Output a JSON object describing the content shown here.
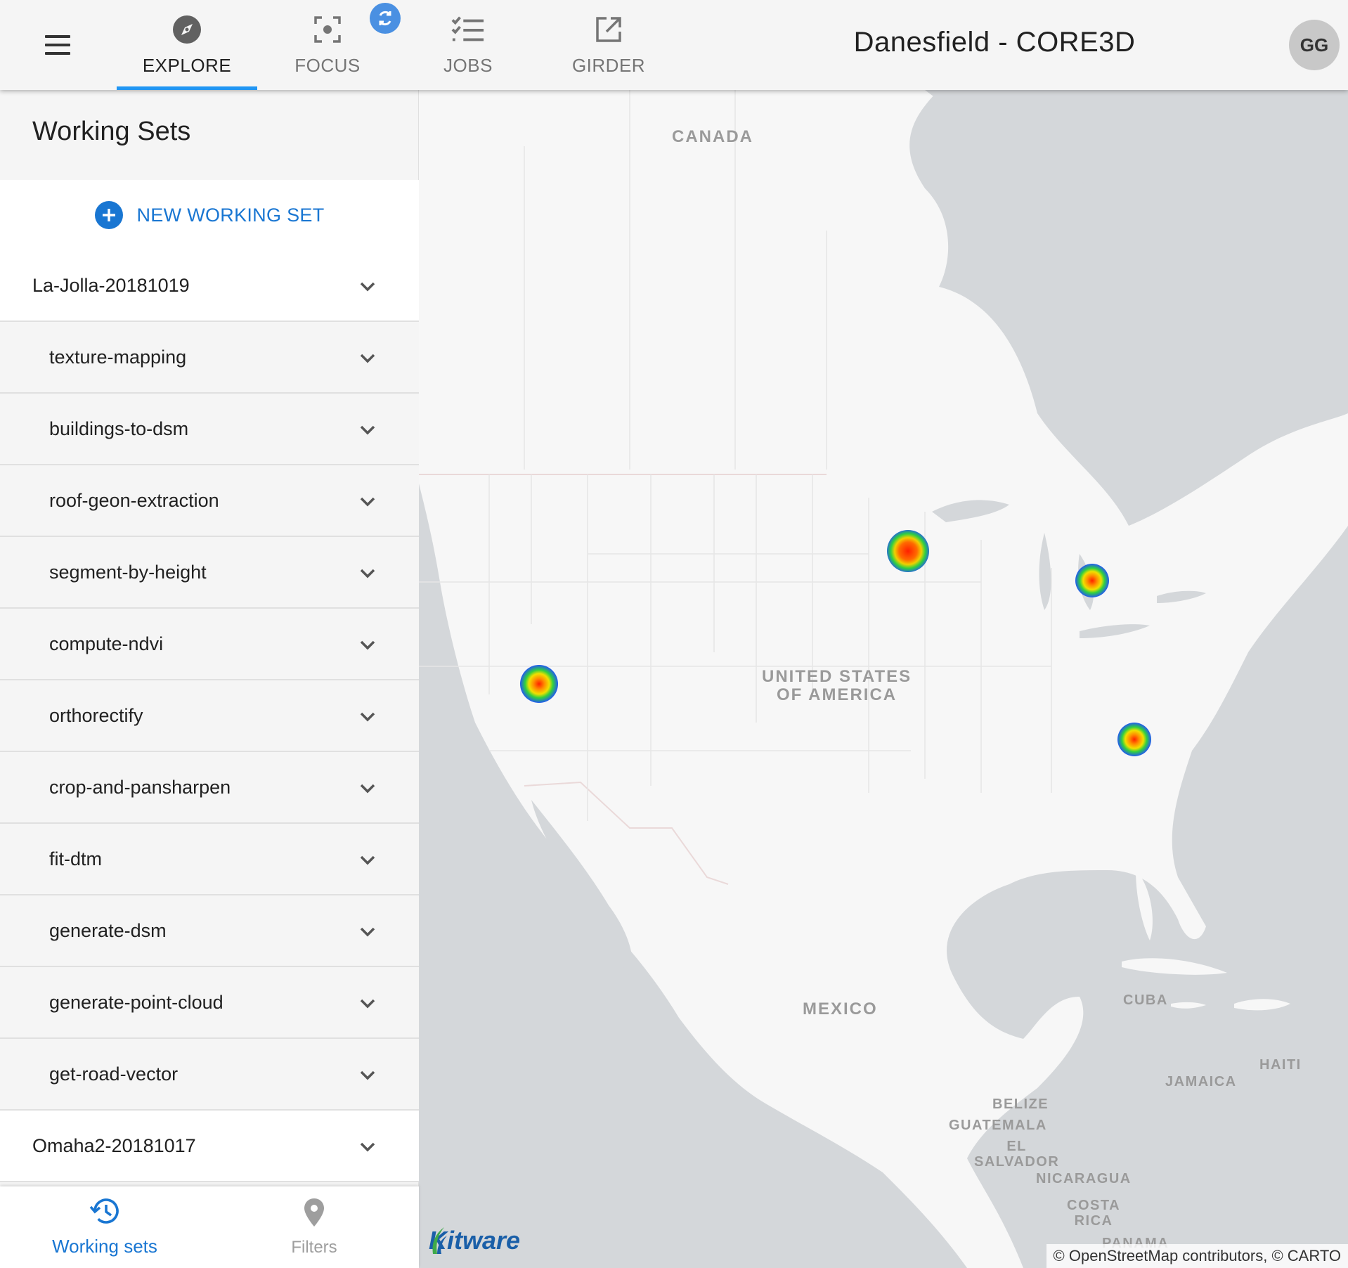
{
  "topbar": {
    "tabs": [
      {
        "label": "EXPLORE",
        "icon": "compass-icon",
        "active": true
      },
      {
        "label": "FOCUS",
        "icon": "focus-icon",
        "active": false
      },
      {
        "label": "JOBS",
        "icon": "checklist-icon",
        "active": false
      },
      {
        "label": "GIRDER",
        "icon": "external-link-icon",
        "active": false
      }
    ],
    "title": "Danesfield - CORE3D",
    "avatar_initials": "GG",
    "accent_color": "#2196f3"
  },
  "sidebar": {
    "title": "Working Sets",
    "new_button_label": "NEW WORKING SET",
    "items": [
      {
        "label": "La-Jolla-20181019",
        "level": "parent"
      },
      {
        "label": "texture-mapping",
        "level": "child"
      },
      {
        "label": "buildings-to-dsm",
        "level": "child"
      },
      {
        "label": "roof-geon-extraction",
        "level": "child"
      },
      {
        "label": "segment-by-height",
        "level": "child"
      },
      {
        "label": "compute-ndvi",
        "level": "child"
      },
      {
        "label": "orthorectify",
        "level": "child"
      },
      {
        "label": "crop-and-pansharpen",
        "level": "child"
      },
      {
        "label": "fit-dtm",
        "level": "child"
      },
      {
        "label": "generate-dsm",
        "level": "child"
      },
      {
        "label": "generate-point-cloud",
        "level": "child"
      },
      {
        "label": "get-road-vector",
        "level": "child"
      },
      {
        "label": "Omaha2-20181017",
        "level": "parent"
      }
    ],
    "bottom_nav": [
      {
        "label": "Working sets",
        "icon": "history-icon",
        "active": true
      },
      {
        "label": "Filters",
        "icon": "map-pin-icon",
        "active": false
      }
    ],
    "primary_color": "#1976d2"
  },
  "map": {
    "labels": {
      "canada": "CANADA",
      "usa": "UNITED STATES\nOF AMERICA",
      "mexico": "MEXICO",
      "cuba": "CUBA",
      "haiti": "HAITI",
      "jamaica": "JAMAICA",
      "belize": "BELIZE",
      "guatemala": "GUATEMALA",
      "el_salvador": "EL\nSALVADOR",
      "nicaragua": "NICARAGUA",
      "costa_rica": "COSTA\nRICA",
      "panama": "PANAMA"
    },
    "attribution": "© OpenStreetMap contributors, © CARTO",
    "logo_text": "Kitware"
  }
}
